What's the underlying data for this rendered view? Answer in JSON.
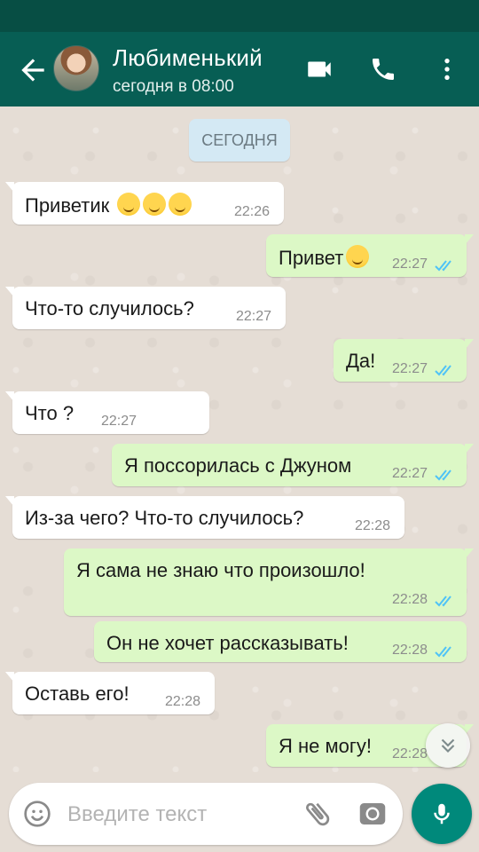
{
  "header": {
    "contact_name": "Любименький",
    "status": "сегодня в 08:00"
  },
  "chat": {
    "date_label": "СЕГОДНЯ",
    "messages": [
      {
        "dir": "in",
        "text": "Приветик",
        "emoji": "🙃🙃🙃",
        "time": "22:26"
      },
      {
        "dir": "out",
        "text": "Привет",
        "emoji": "😔",
        "time": "22:27",
        "read": true
      },
      {
        "dir": "in",
        "text": "Что-то случилось?",
        "time": "22:27"
      },
      {
        "dir": "out",
        "text": "Да!",
        "time": "22:27",
        "read": true
      },
      {
        "dir": "in",
        "text": "Что ?",
        "time": "22:27"
      },
      {
        "dir": "out",
        "text": "Я поссорилась с Джуном",
        "time": "22:27",
        "read": true
      },
      {
        "dir": "in",
        "text": "Из-за чего? Что-то случилось?",
        "time": "22:28"
      },
      {
        "dir": "out",
        "text": "Я сама не знаю что произошло!",
        "time": "22:28",
        "read": true
      },
      {
        "dir": "out",
        "text": "Он не хочет рассказывать!",
        "time": "22:28",
        "read": true
      },
      {
        "dir": "in",
        "text": "Оставь его!",
        "time": "22:28"
      },
      {
        "dir": "out",
        "text": "Я не могу!",
        "time": "22:28",
        "read": true
      }
    ]
  },
  "composer": {
    "placeholder": "Введите текст"
  },
  "icons": {
    "back": "arrow-left-icon",
    "video": "videocam-icon",
    "call": "phone-icon",
    "menu": "more-vert-icon",
    "emoji": "emoji-icon",
    "attach": "paperclip-icon",
    "camera": "camera-icon",
    "mic": "mic-icon",
    "scroll": "double-chevron-down-icon"
  },
  "colors": {
    "header": "#075e54",
    "outgoing_bubble": "#dcf8c6",
    "incoming_bubble": "#ffffff",
    "read_ticks": "#4fc3f7",
    "mic_button": "#00897b"
  }
}
